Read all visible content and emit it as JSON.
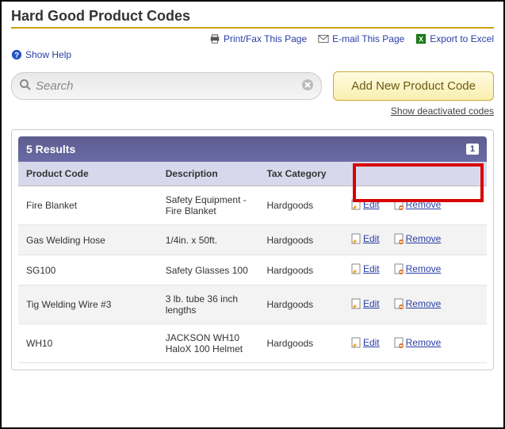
{
  "page_title": "Hard Good Product Codes",
  "toolbar": {
    "print_label": "Print/Fax This Page",
    "email_label": "E-mail This Page",
    "excel_label": "Export to Excel"
  },
  "help_label": "Show Help",
  "search": {
    "placeholder": "Search"
  },
  "add_button_label": "Add New Product Code",
  "deactivated_link": "Show deactivated codes",
  "results": {
    "header": "5 Results",
    "current_page": "1",
    "columns": {
      "code": "Product Code",
      "desc": "Description",
      "tax": "Tax Category"
    }
  },
  "actions": {
    "edit": "Edit",
    "remove": "Remove"
  },
  "rows": [
    {
      "code": "Fire Blanket",
      "desc": "Safety Equipment - Fire Blanket",
      "tax": "Hardgoods"
    },
    {
      "code": "Gas Welding Hose",
      "desc": "1/4in. x 50ft.",
      "tax": "Hardgoods"
    },
    {
      "code": "SG100",
      "desc": "Safety Glasses 100",
      "tax": "Hardgoods"
    },
    {
      "code": "Tig Welding Wire #3",
      "desc": "3 lb. tube 36 inch lengths",
      "tax": "Hardgoods"
    },
    {
      "code": "WH10",
      "desc": "JACKSON WH10 HaloX 100 Helmet",
      "tax": "Hardgoods"
    }
  ]
}
